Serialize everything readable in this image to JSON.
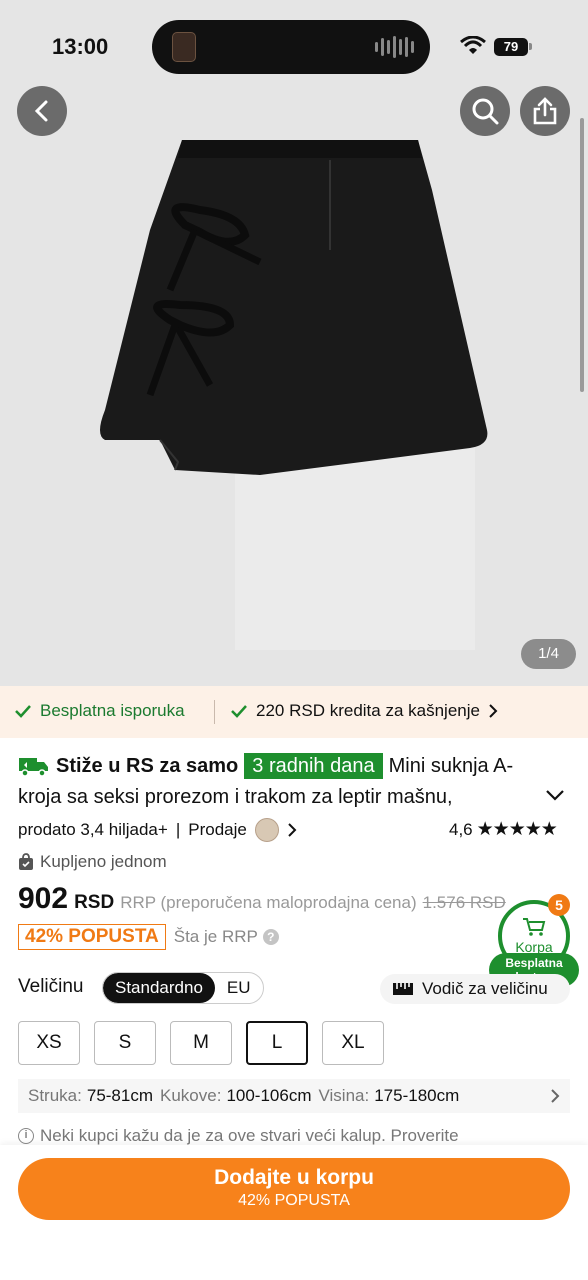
{
  "status_bar": {
    "time": "13:00",
    "battery": "79"
  },
  "gallery": {
    "counter": "1/4"
  },
  "benefits": {
    "free_shipping": "Besplatna isporuka",
    "late_credit": "220 RSD kredita za kašnjenje"
  },
  "product": {
    "ship_prefix": "Stiže u RS za samo",
    "ship_days": "3 radnih dana",
    "title_1": "Mini suknja A-",
    "title_2": "kroja sa seksi prorezom i trakom za leptir mašnu,",
    "sold": "prodato 3,4 hiljada+",
    "sep": "|",
    "seller": "Prodaje",
    "rating": "4,6",
    "stars": "★★★★★",
    "bought": "Kupljeno jednom",
    "price": "902",
    "currency": "RSD",
    "rrp_label": "RRP (preporučena maloprodajna cena)",
    "rrp_price": "1.576 RSD",
    "discount": "42% POPUSTA",
    "rrp_what": "Šta je RRP"
  },
  "cart": {
    "label": "Korpa",
    "count": "5",
    "free_line1": "Besplatna",
    "free_line2": "dostava"
  },
  "size": {
    "label": "Veličinu",
    "toggle": [
      "Standardno",
      "EU"
    ],
    "guide": "Vodič za veličinu",
    "options": [
      "XS",
      "S",
      "M",
      "L",
      "XL"
    ],
    "selected": "L"
  },
  "measurements": {
    "waist_label": "Struka:",
    "waist": "75-81cm",
    "hips_label": "Kukove:",
    "hips": "100-106cm",
    "height_label": "Visina:",
    "height": "175-180cm"
  },
  "fit_note": "Neki kupci kažu da je za ove stvari veći kalup. Proverite",
  "cta": {
    "main": "Dodajte u korpu",
    "sub": "42% POPUSTA"
  },
  "colors": {
    "accent": "#f7821b",
    "green": "#1e8f2e",
    "benefit_bg": "#fdf1e7"
  }
}
